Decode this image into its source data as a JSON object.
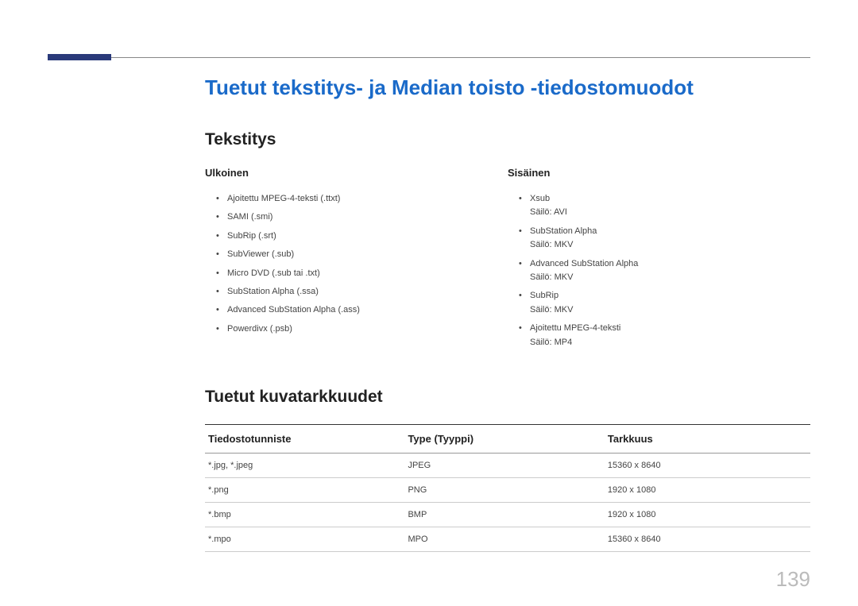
{
  "mainTitle": "Tuetut tekstitys- ja Median toisto -tiedostomuodot",
  "section1": {
    "title": "Tekstitys",
    "left": {
      "header": "Ulkoinen",
      "items": [
        {
          "text": "Ajoitettu MPEG-4-teksti (.ttxt)"
        },
        {
          "text": "SAMI (.smi)"
        },
        {
          "text": "SubRip (.srt)"
        },
        {
          "text": "SubViewer (.sub)"
        },
        {
          "text": "Micro DVD (.sub tai .txt)"
        },
        {
          "text": "SubStation Alpha (.ssa)"
        },
        {
          "text": "Advanced SubStation Alpha (.ass)"
        },
        {
          "text": "Powerdivx (.psb)"
        }
      ]
    },
    "right": {
      "header": "Sisäinen",
      "items": [
        {
          "text": "Xsub",
          "sub": "Säilö: AVI"
        },
        {
          "text": "SubStation Alpha",
          "sub": "Säilö: MKV"
        },
        {
          "text": "Advanced SubStation Alpha",
          "sub": "Säilö: MKV"
        },
        {
          "text": "SubRip",
          "sub": "Säilö: MKV"
        },
        {
          "text": "Ajoitettu MPEG-4-teksti",
          "sub": "Säilö: MP4"
        }
      ]
    }
  },
  "section2": {
    "title": "Tuetut kuvatarkkuudet",
    "headers": [
      "Tiedostotunniste",
      "Type (Tyyppi)",
      "Tarkkuus"
    ],
    "rows": [
      [
        "*.jpg, *.jpeg",
        "JPEG",
        "15360 x 8640"
      ],
      [
        "*.png",
        "PNG",
        "1920 x 1080"
      ],
      [
        "*.bmp",
        "BMP",
        "1920 x 1080"
      ],
      [
        "*.mpo",
        "MPO",
        "15360 x 8640"
      ]
    ]
  },
  "pageNumber": "139"
}
